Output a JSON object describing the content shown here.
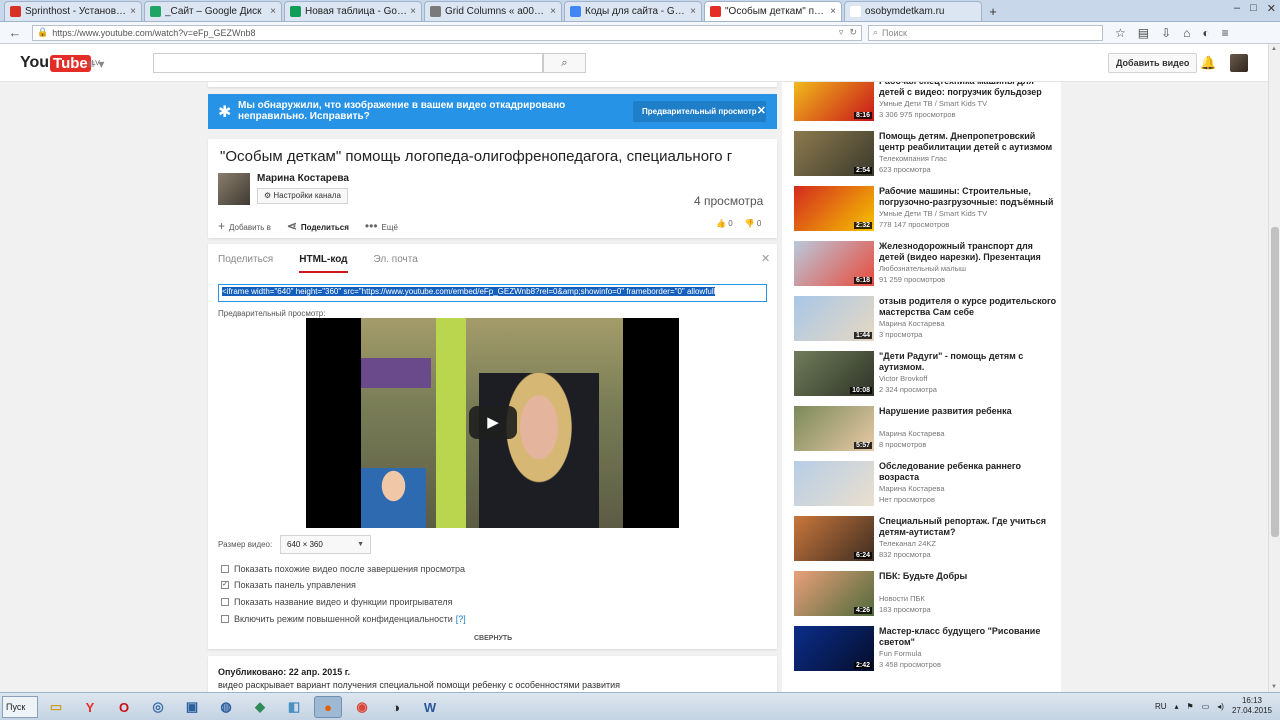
{
  "browser": {
    "tabs": [
      {
        "label": "Sprinthost - Установка Word...",
        "color": "#d93025"
      },
      {
        "label": "_Сайт – Google Диск",
        "color": "#1fa463"
      },
      {
        "label": "Новая таблица - Google Таб...",
        "color": "#0f9d58"
      },
      {
        "label": "Grid Columns « a0009430.xsp...",
        "color": "#7a7a7a"
      },
      {
        "label": "Коды для сайта - Google До...",
        "color": "#4285f4"
      },
      {
        "label": "\"Особым деткам\" помощь л...",
        "color": "#e52d27"
      },
      {
        "label": "osobymdetkam.ru",
        "color": "#ffffff"
      }
    ],
    "url": "https://www.youtube.com/watch?v=eFp_GEZWnb8",
    "search_placeholder": "Поиск"
  },
  "yt": {
    "logo_left": "You",
    "logo_right": "Tube",
    "country": "LV",
    "upload_label": "Добавить видео"
  },
  "notice": {
    "text": "Мы обнаружили, что изображение в вашем видео откадрировано неправильно. Исправить?",
    "button": "Предварительный просмотр"
  },
  "video": {
    "title": "\"Особым деткам\" помощь логопеда-олигофренопедагога, специального г",
    "owner": "Марина Костарева",
    "channel_settings": "Настройки канала",
    "views": "4 просмотра",
    "actions": {
      "add": "Добавить в",
      "share": "Поделиться",
      "more": "Ещё"
    },
    "likes": "0",
    "dislikes": "0"
  },
  "share": {
    "tabs": [
      "Поделиться",
      "HTML-код",
      "Эл. почта"
    ],
    "embed_code": "<iframe width=\"640\" height=\"360\" src=\"https://www.youtube.com/embed/eFp_GEZWnb8?rel=0&amp;showinfo=0\" frameborder=\"0\" allowfull",
    "preview_label": "Предварительный просмотр:",
    "size_label": "Размер видео:",
    "size_value": "640 × 360",
    "options": [
      {
        "label": "Показать похожие видео после завершения просмотра",
        "checked": false
      },
      {
        "label": "Показать панель управления",
        "checked": true
      },
      {
        "label": "Показать название видео и функции проигрывателя",
        "checked": false
      },
      {
        "label": "Включить режим повышенной конфиденциальности",
        "checked": false,
        "help": "[?]"
      }
    ],
    "collapse": "СВЕРНУТЬ"
  },
  "description": {
    "published": "Опубликовано: 22 апр. 2015 г.",
    "text": "видео раскрывает вариант получения специальной помощи ребенку с особенностями развития"
  },
  "sidebar": {
    "items": [
      {
        "title": "Рабочая спецтехника машины для детей с видео: погрузчик бульдозер",
        "channel": "Умные Дети ТВ / Smart Kids TV",
        "views": "3 306 975 просмотров",
        "duration": "8:16",
        "c1": "#f3c21b",
        "c2": "#c8151b"
      },
      {
        "title": "Помощь детям. Днепропетровский центр реабилитации детей с аутизмом",
        "channel": "Телекомпания Глас",
        "views": "623 просмотра",
        "duration": "2:54",
        "c1": "#8c7a4e",
        "c2": "#3b3a2c"
      },
      {
        "title": "Рабочие машины: Строительные, погрузочно-разгрузочные: подъёмный",
        "channel": "Умные Дети ТВ / Smart Kids TV",
        "views": "778 147 просмотров",
        "duration": "2:32",
        "c1": "#d42a1f",
        "c2": "#f5c400"
      },
      {
        "title": "Железнодорожный транспорт для детей (видео нарезки). Презентация",
        "channel": "Любознательный малыш",
        "views": "91 259 просмотров",
        "duration": "6:18",
        "c1": "#b9c9dc",
        "c2": "#e84a3b"
      },
      {
        "title": "отзыв родителя о курсе родительского мастерства Сам себе",
        "channel": "Марина Костарева",
        "views": "3 просмотра",
        "duration": "1:44",
        "c1": "#a9c7e8",
        "c2": "#e6d8c2"
      },
      {
        "title": "\"Дети Радуги\" - помощь детям с аутизмом.",
        "channel": "Victor Brovkoff",
        "views": "2 324 просмотра",
        "duration": "10:08",
        "c1": "#6f7d5a",
        "c2": "#2f3328"
      },
      {
        "title": "Нарушение развития ребенка",
        "channel": "Марина Костарева",
        "views": "8 просмотров",
        "duration": "5:57",
        "c1": "#7a8a5a",
        "c2": "#e8c9a6"
      },
      {
        "title": "Обследование ребенка раннего возраста",
        "channel": "Марина Костарева",
        "views": "Нет просмотров",
        "duration": "",
        "c1": "#b7cde6",
        "c2": "#eadfce"
      },
      {
        "title": "Специальный репортаж. Где учиться детям-аутистам?",
        "channel": "Телеканал 24KZ",
        "views": "832 просмотра",
        "duration": "6:24",
        "c1": "#c9773b",
        "c2": "#3e2d22"
      },
      {
        "title": "ПБК: Будьте Добры",
        "channel": "Новости ПБК",
        "views": "183 просмотра",
        "duration": "4:26",
        "c1": "#e9a07a",
        "c2": "#4f6a3c"
      },
      {
        "title": "Мастер-класс будущего \"Рисование светом\"",
        "channel": "Fun Formula",
        "views": "3 458 просмотров",
        "duration": "2:42",
        "c1": "#0b2e8a",
        "c2": "#050d2b"
      }
    ]
  },
  "taskbar": {
    "start": "Пуск",
    "lang": "RU",
    "time": "16:13",
    "date": "27.04.2015"
  }
}
